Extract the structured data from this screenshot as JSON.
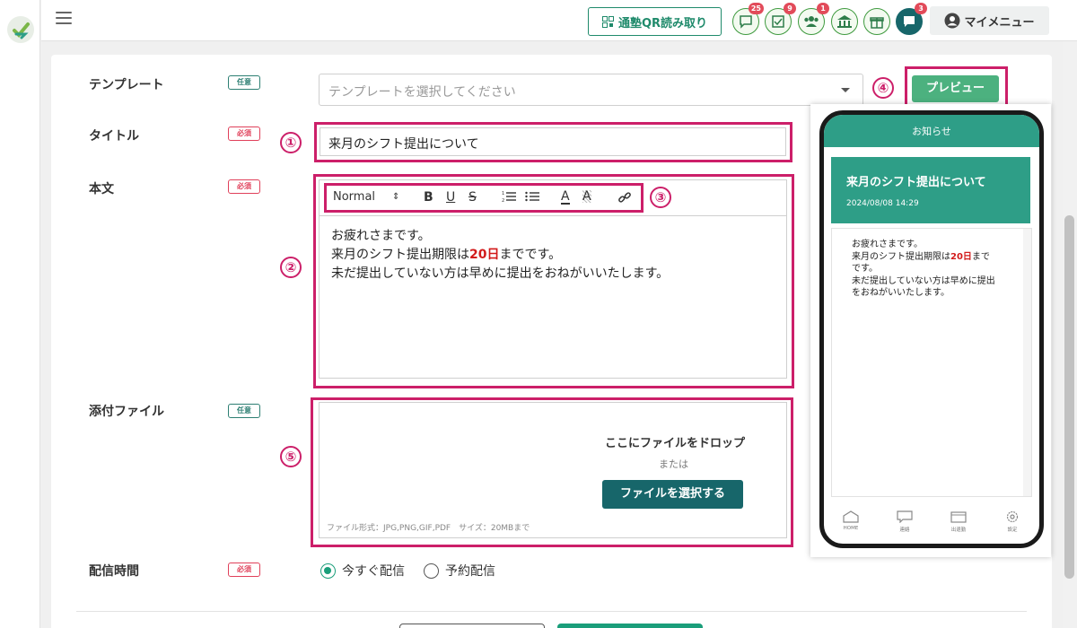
{
  "header": {
    "qr_button": "通塾QR読み取り",
    "icons": [
      {
        "name": "chat-icon",
        "badge": "25"
      },
      {
        "name": "checklist-icon",
        "badge": "9"
      },
      {
        "name": "users-icon",
        "badge": "1"
      },
      {
        "name": "school-icon",
        "badge": ""
      },
      {
        "name": "gift-icon",
        "badge": ""
      },
      {
        "name": "message-icon",
        "badge": "3"
      }
    ],
    "my_menu": "マイメニュー"
  },
  "form": {
    "template": {
      "label": "テンプレート",
      "tag": "任意",
      "placeholder": "テンプレートを選択してください"
    },
    "title": {
      "label": "タイトル",
      "tag": "必須",
      "value": "来月のシフト提出について"
    },
    "body": {
      "label": "本文",
      "tag": "必須",
      "toolbar_format": "Normal",
      "line1": "お疲れさまです。",
      "line2_pre": "来月のシフト提出期限は",
      "line2_highlight": "20日",
      "line2_post": "までです。",
      "line3": "未だ提出していない方は早めに提出をおねがいいたします。"
    },
    "attachment": {
      "label": "添付ファイル",
      "tag": "任意",
      "drop_text": "ここにファイルをドロップ",
      "or_text": "または",
      "select_button": "ファイルを選択する",
      "note": "ファイル形式：JPG,PNG,GIF,PDF　サイズ：20MBまで"
    },
    "delivery": {
      "label": "配信時間",
      "tag": "必須",
      "option_now": "今すぐ配信",
      "option_scheduled": "予約配信"
    }
  },
  "callouts": [
    "①",
    "②",
    "③",
    "④",
    "⑤"
  ],
  "preview": {
    "button": "プレビュー",
    "header": "お知らせ",
    "title": "来月のシフト提出について",
    "date": "2024/08/08 14:29",
    "body_line1": "お疲れさまです。",
    "body_line2_pre": "来月のシフト提出期限は",
    "body_line2_highlight": "20日",
    "body_line2_post": "まで",
    "body_line3": "です。",
    "body_line4": "未だ提出していない方は早めに提出",
    "body_line5": "をおねがいいたします。",
    "nav": {
      "home": "HOME",
      "contact": "連絡",
      "attendance": "出退勤",
      "settings": "設定"
    }
  },
  "colors": {
    "primary": "#17666a",
    "accent": "#1a9e7a",
    "highlight": "#cc1f69",
    "required": "#e0405a",
    "preview_green": "#4cb17f"
  }
}
